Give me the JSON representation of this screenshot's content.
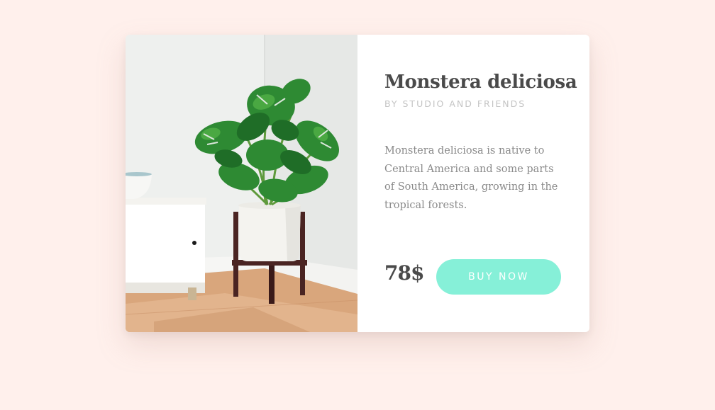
{
  "product": {
    "title": "Monstera deliciosa",
    "byline": "BY STUDIO AND FRIENDS",
    "description": "Monstera deliciosa is native to Central America and some parts of South America, growing in the tropical forests.",
    "price": "78$",
    "buy_label": "BUY NOW",
    "image_subject": "potted-monstera-plant"
  },
  "colors": {
    "background": "#fff0ec",
    "card": "#ffffff",
    "accent": "#86f0d8",
    "title": "#4a4a4a",
    "byline": "#c4c4c4",
    "text": "#8a8a8a"
  }
}
